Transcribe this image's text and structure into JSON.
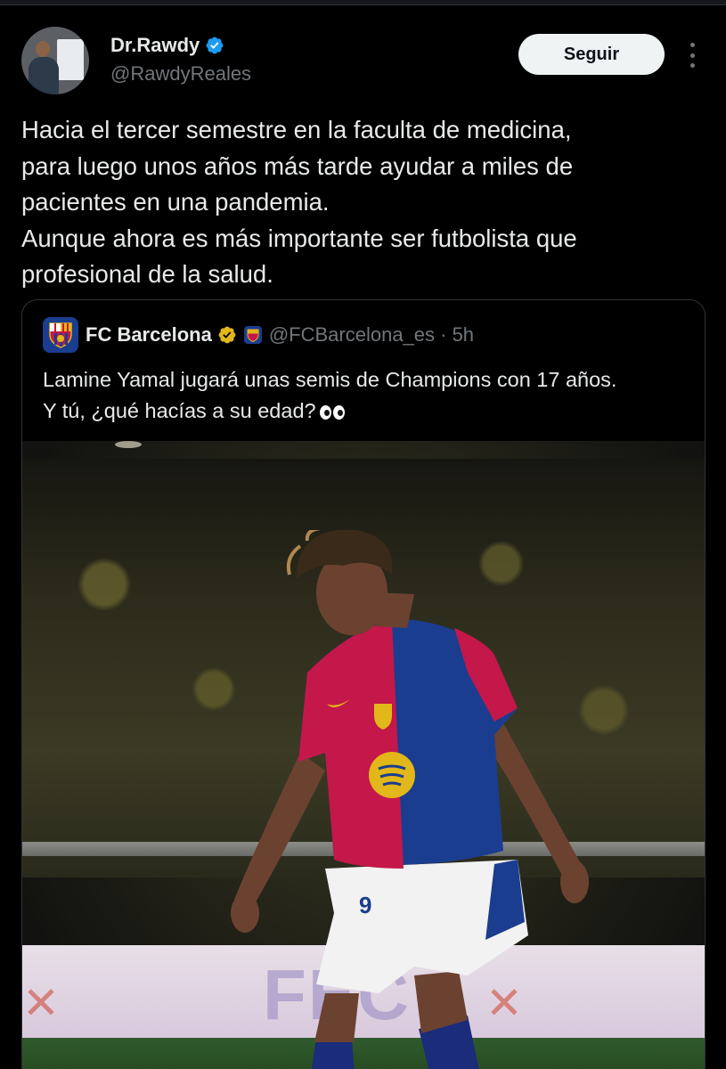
{
  "tweet": {
    "author": {
      "display_name": "Dr.Rawdy",
      "handle": "@RawdyReales",
      "verified_color": "#1d9bf0"
    },
    "follow_button": "Seguir",
    "more_icon": "more-vertical-icon",
    "text_lines": [
      "Hacia el tercer semestre en la faculta de medicina,",
      "para luego unos años más tarde ayudar a miles de",
      "pacientes en una pandemia.",
      "Aunque ahora es más importante ser futbolista que",
      "profesional de la salud."
    ]
  },
  "quote": {
    "author": {
      "display_name": "FC Barcelona",
      "handle_time": "@FCBarcelona_es · 5h",
      "badge_color": "#e2b719"
    },
    "text_lines": [
      "Lamine Yamal jugará unas semis de Champions con 17 años.",
      "Y tú, ¿qué hacías a su edad?"
    ],
    "emoji": "eyes-emoji-icon",
    "photo": {
      "jersey_number": "9",
      "board_text": "FEC"
    }
  },
  "colors": {
    "background": "#000000",
    "text": "#e7e9ea",
    "secondary_text": "#71767b",
    "border": "#2f3336",
    "barca_blue": "#1a3d8f",
    "barca_red": "#c4174a"
  }
}
